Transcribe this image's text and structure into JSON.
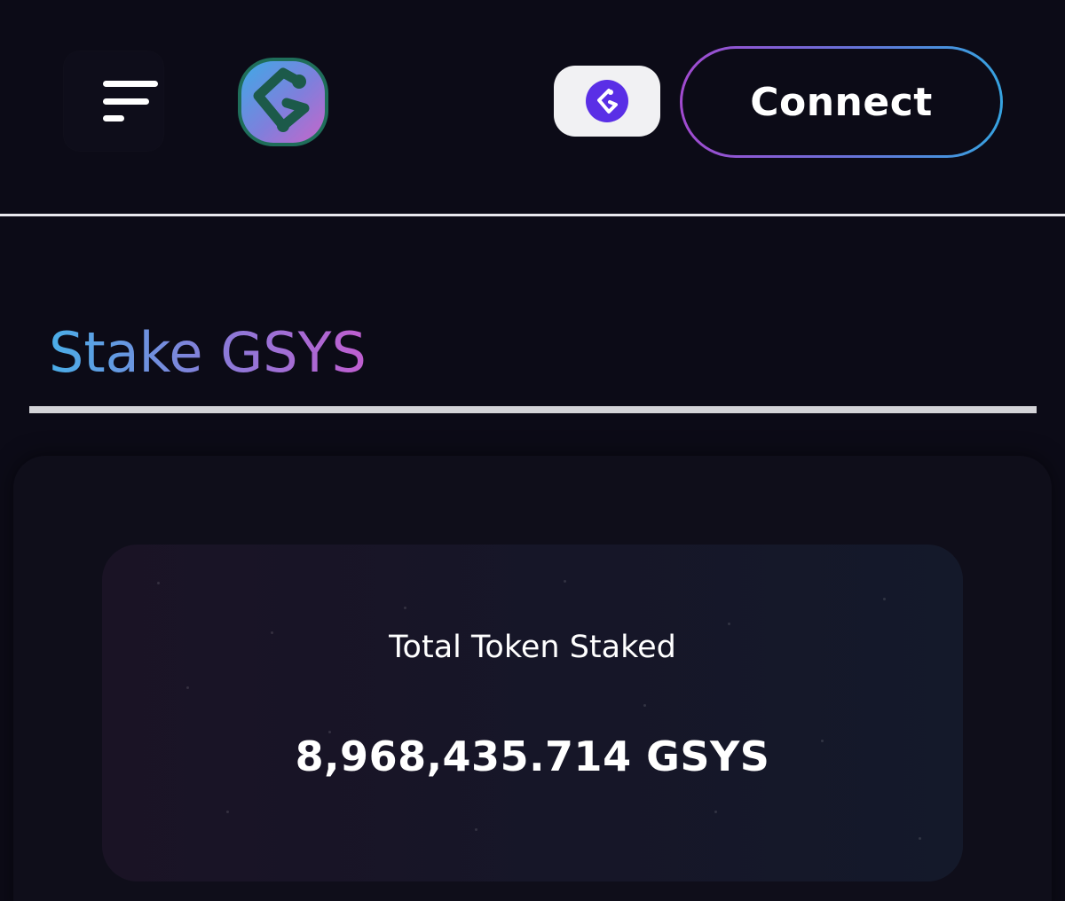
{
  "header": {
    "menu_icon": "menu-lines-icon",
    "logo_icon": "gsys-logo-icon",
    "network_icon": "network-token-icon",
    "connect_label": "Connect"
  },
  "page": {
    "title": "Stake GSYS"
  },
  "stats": {
    "label": "Total Token Staked",
    "value": "8,968,435.714 GSYS"
  },
  "colors": {
    "background": "#0c0b17",
    "accent_blue": "#4aaee8",
    "accent_purple": "#c05ed0",
    "network_icon_bg": "#5a2fe6"
  }
}
